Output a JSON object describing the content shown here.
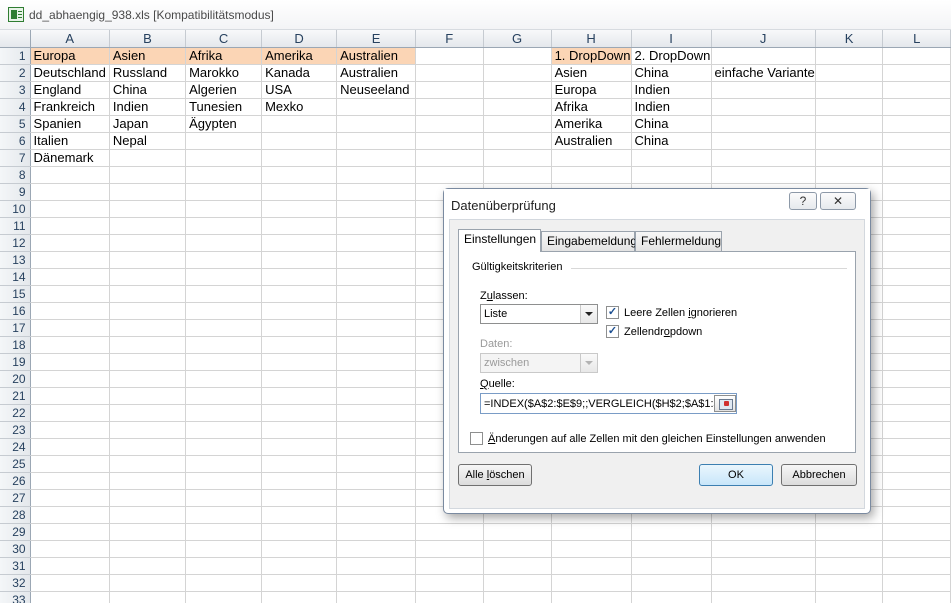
{
  "window": {
    "title": "dd_abhaengig_938.xls  [Kompatibilitätsmodus]"
  },
  "sheet": {
    "columns": [
      "A",
      "B",
      "C",
      "D",
      "E",
      "F",
      "G",
      "H",
      "I",
      "J",
      "K",
      "L"
    ],
    "rows": [
      [
        "Europa",
        "Asien",
        "Afrika",
        "Amerika",
        "Australien",
        "",
        "",
        "1. DropDown",
        "2. DropDown",
        "",
        "",
        ""
      ],
      [
        "Deutschland",
        "Russland",
        "Marokko",
        "Kanada",
        "Australien",
        "",
        "",
        "Asien",
        "China",
        "einfache Variante",
        "",
        ""
      ],
      [
        "England",
        "China",
        "Algerien",
        "USA",
        "Neuseeland",
        "",
        "",
        "Europa",
        "Indien",
        "",
        "",
        ""
      ],
      [
        "Frankreich",
        "Indien",
        "Tunesien",
        "Mexko",
        "",
        "",
        "",
        "Afrika",
        "Indien",
        "",
        "",
        ""
      ],
      [
        "Spanien",
        "Japan",
        "Ägypten",
        "",
        "",
        "",
        "",
        "Amerika",
        "China",
        "",
        "",
        ""
      ],
      [
        "Italien",
        "Nepal",
        "",
        "",
        "",
        "",
        "",
        "Australien",
        "China",
        "",
        "",
        ""
      ],
      [
        "Dänemark",
        "",
        "",
        "",
        "",
        "",
        "",
        "",
        "",
        "",
        "",
        ""
      ]
    ],
    "total_rows": 33
  },
  "dialog": {
    "title": "Datenüberprüfung",
    "help_glyph": "?",
    "close_glyph": "✕",
    "tabs": [
      "Einstellungen",
      "Eingabemeldung",
      "Fehlermeldung"
    ],
    "group_label": "Gültigkeitskriterien",
    "allow_label_pre": "Z",
    "allow_label_u": "u",
    "allow_label_post": "lassen:",
    "allow_value": "Liste",
    "ignore_blank_pre": "Leere Zellen ",
    "ignore_blank_u": "i",
    "ignore_blank_post": "gnorieren",
    "ignore_blank_checked": true,
    "incell_pre": "Zellendr",
    "incell_u": "o",
    "incell_post": "pdown",
    "incell_checked": true,
    "data_label": "Daten:",
    "data_value": "zwischen",
    "source_label_pre": "",
    "source_label_u": "Q",
    "source_label_post": "uelle:",
    "source_value": "=INDEX($A$2:$E$9;;VERGLEICH($H$2;$A$1:$",
    "apply_all_pre": "",
    "apply_all_u": "Ä",
    "apply_all_post": "nderungen auf alle Zellen mit den gleichen Einstellungen anwenden",
    "apply_all_checked": false,
    "clear_all_pre": "Alle ",
    "clear_all_u": "l",
    "clear_all_post": "öschen",
    "ok_label": "OK",
    "cancel_label": "Abbrechen"
  }
}
